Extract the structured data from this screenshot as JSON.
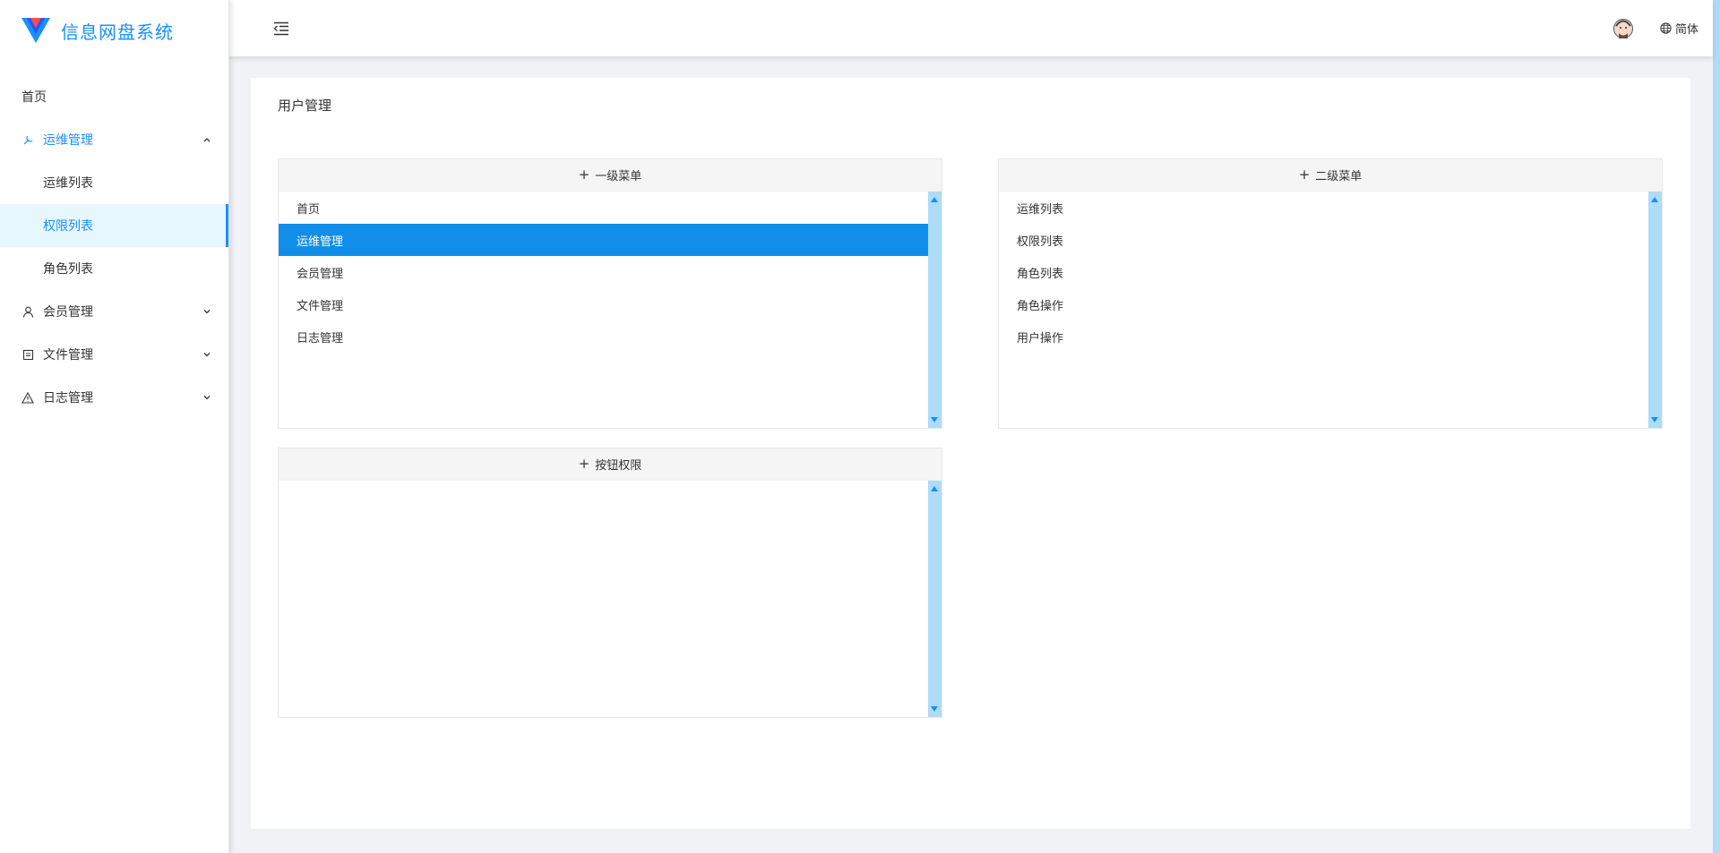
{
  "brand": {
    "title": "信息网盘系统"
  },
  "sidebar": {
    "items": [
      {
        "label": "首页"
      },
      {
        "label": "运维管理"
      },
      {
        "label": "运维列表"
      },
      {
        "label": "权限列表"
      },
      {
        "label": "角色列表"
      },
      {
        "label": "会员管理"
      },
      {
        "label": "文件管理"
      },
      {
        "label": "日志管理"
      }
    ]
  },
  "header": {
    "language": "简体"
  },
  "main": {
    "title": "用户管理",
    "panels": {
      "level1": {
        "title": "一级菜单",
        "items": [
          "首页",
          "运维管理",
          "会员管理",
          "文件管理",
          "日志管理"
        ],
        "selected": "运维管理"
      },
      "level2": {
        "title": "二级菜单",
        "items": [
          "运维列表",
          "权限列表",
          "角色列表",
          "角色操作",
          "用户操作"
        ]
      },
      "buttons": {
        "title": "按钮权限",
        "items": []
      }
    }
  },
  "colors": {
    "accent": "#1890ff",
    "selected_row": "#108ee9",
    "scrollbar": "#aedcf8"
  },
  "icons": {
    "fold": "menu-fold-icon",
    "ops": "tool-icon",
    "member": "user-icon",
    "file": "file-icon",
    "log": "warning-icon",
    "language": "globe-icon"
  }
}
